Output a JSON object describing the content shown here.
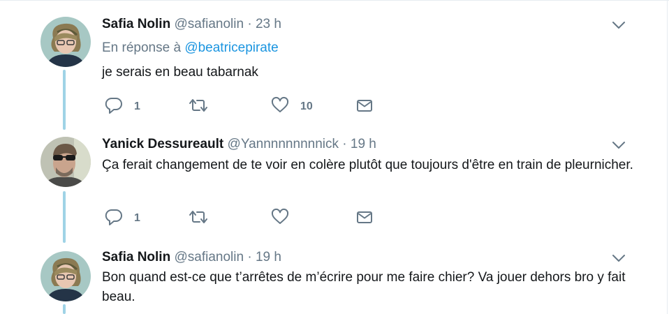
{
  "tweets": [
    {
      "fullname": "Safia Nolin",
      "username": "@safianolin",
      "separator": "·",
      "time": "23 h",
      "reply_prefix": "En réponse à",
      "reply_mention": "@beatricepirate",
      "text": "je serais en beau tabarnak",
      "reply_count": "1",
      "retweet_count": "",
      "like_count": "10",
      "icons": [
        "avatar",
        "chevron-down-icon",
        "reply-icon",
        "retweet-icon",
        "like-icon",
        "message-icon"
      ]
    },
    {
      "fullname": "Yanick Dessureault",
      "username": "@Yannnnnnnnnick",
      "separator": "·",
      "time": "19 h",
      "text": "Ça ferait changement de te voir en colère plutôt que toujours d'être en train de pleurnicher.",
      "reply_count": "1",
      "retweet_count": "",
      "like_count": "",
      "icons": [
        "avatar",
        "chevron-down-icon",
        "reply-icon",
        "retweet-icon",
        "like-icon",
        "message-icon"
      ]
    },
    {
      "fullname": "Safia Nolin",
      "username": "@safianolin",
      "separator": "·",
      "time": "19 h",
      "text": "Bon quand est-ce que t’arrêtes de m’écrire pour me faire chier? Va jouer dehors bro y fait beau.",
      "icons": [
        "avatar",
        "chevron-down-icon"
      ]
    }
  ],
  "colors": {
    "text": "#14171a",
    "secondary": "#657786",
    "link": "#1b95e0",
    "thread_line": "#9fd3e6",
    "border": "#e6ecf0"
  }
}
